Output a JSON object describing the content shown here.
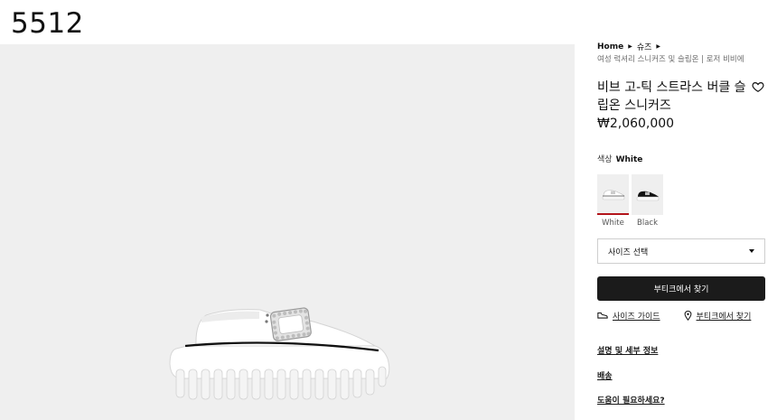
{
  "page_id": "5512",
  "breadcrumb": {
    "home": "Home",
    "category": "슈즈",
    "sub": "여성 럭셔리 스니커즈 및 슬립온 | 로저 비비에"
  },
  "product": {
    "title": "비브 고-틱 스트라스 버클 슬립온 스니커즈",
    "price": "₩2,060,000",
    "image_icon": "white-platform-sneaker-with-crystal-buckle"
  },
  "color": {
    "label": "색상",
    "selected": "White",
    "options": [
      {
        "label": "White",
        "thumb_color": "#ffffff"
      },
      {
        "label": "Black",
        "thumb_color": "#111111"
      }
    ],
    "active_color": "#b3151b"
  },
  "size_select": {
    "placeholder": "사이즈 선택"
  },
  "find_button": {
    "label": "부티크에서 찾기"
  },
  "links": {
    "size_guide": "사이즈 가이드",
    "find_boutique": "부티크에서 찾기"
  },
  "accordion": {
    "details": "설명 및 세부 정보",
    "delivery": "배송",
    "help": "도움이 필요하세요?"
  },
  "icons": {
    "wishlist": "heart-icon",
    "size_guide": "shoe-icon",
    "boutique": "location-pin-icon",
    "dropdown": "chevron-down-icon"
  }
}
